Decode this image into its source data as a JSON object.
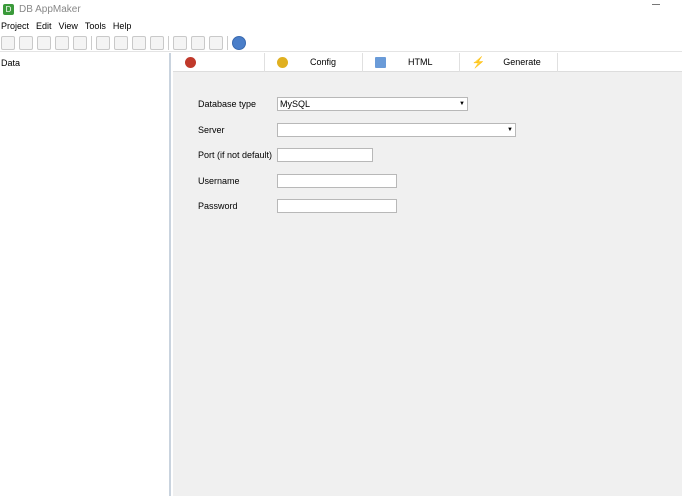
{
  "window": {
    "title": "DB AppMaker",
    "app_icon_letter": "D"
  },
  "menu": [
    "Project",
    "Edit",
    "View",
    "Tools",
    "Help"
  ],
  "left_panel": {
    "header": "Data"
  },
  "tabs": [
    {
      "label": "",
      "icon": "database-icon",
      "color": "#c0392b"
    },
    {
      "label": "Config",
      "icon": "config-icon",
      "color": "#e0b020"
    },
    {
      "label": "HTML",
      "icon": "html-icon",
      "color": "#6a9bd8"
    },
    {
      "label": "Generate",
      "icon": "lightning-icon",
      "color": "#e8c020"
    }
  ],
  "form": {
    "database_type": {
      "label": "Database type",
      "value": "MySQL"
    },
    "server": {
      "label": "Server",
      "value": ""
    },
    "port": {
      "label": "Port (if not default)",
      "value": ""
    },
    "username": {
      "label": "Username",
      "value": ""
    },
    "password": {
      "label": "Password",
      "value": ""
    }
  }
}
